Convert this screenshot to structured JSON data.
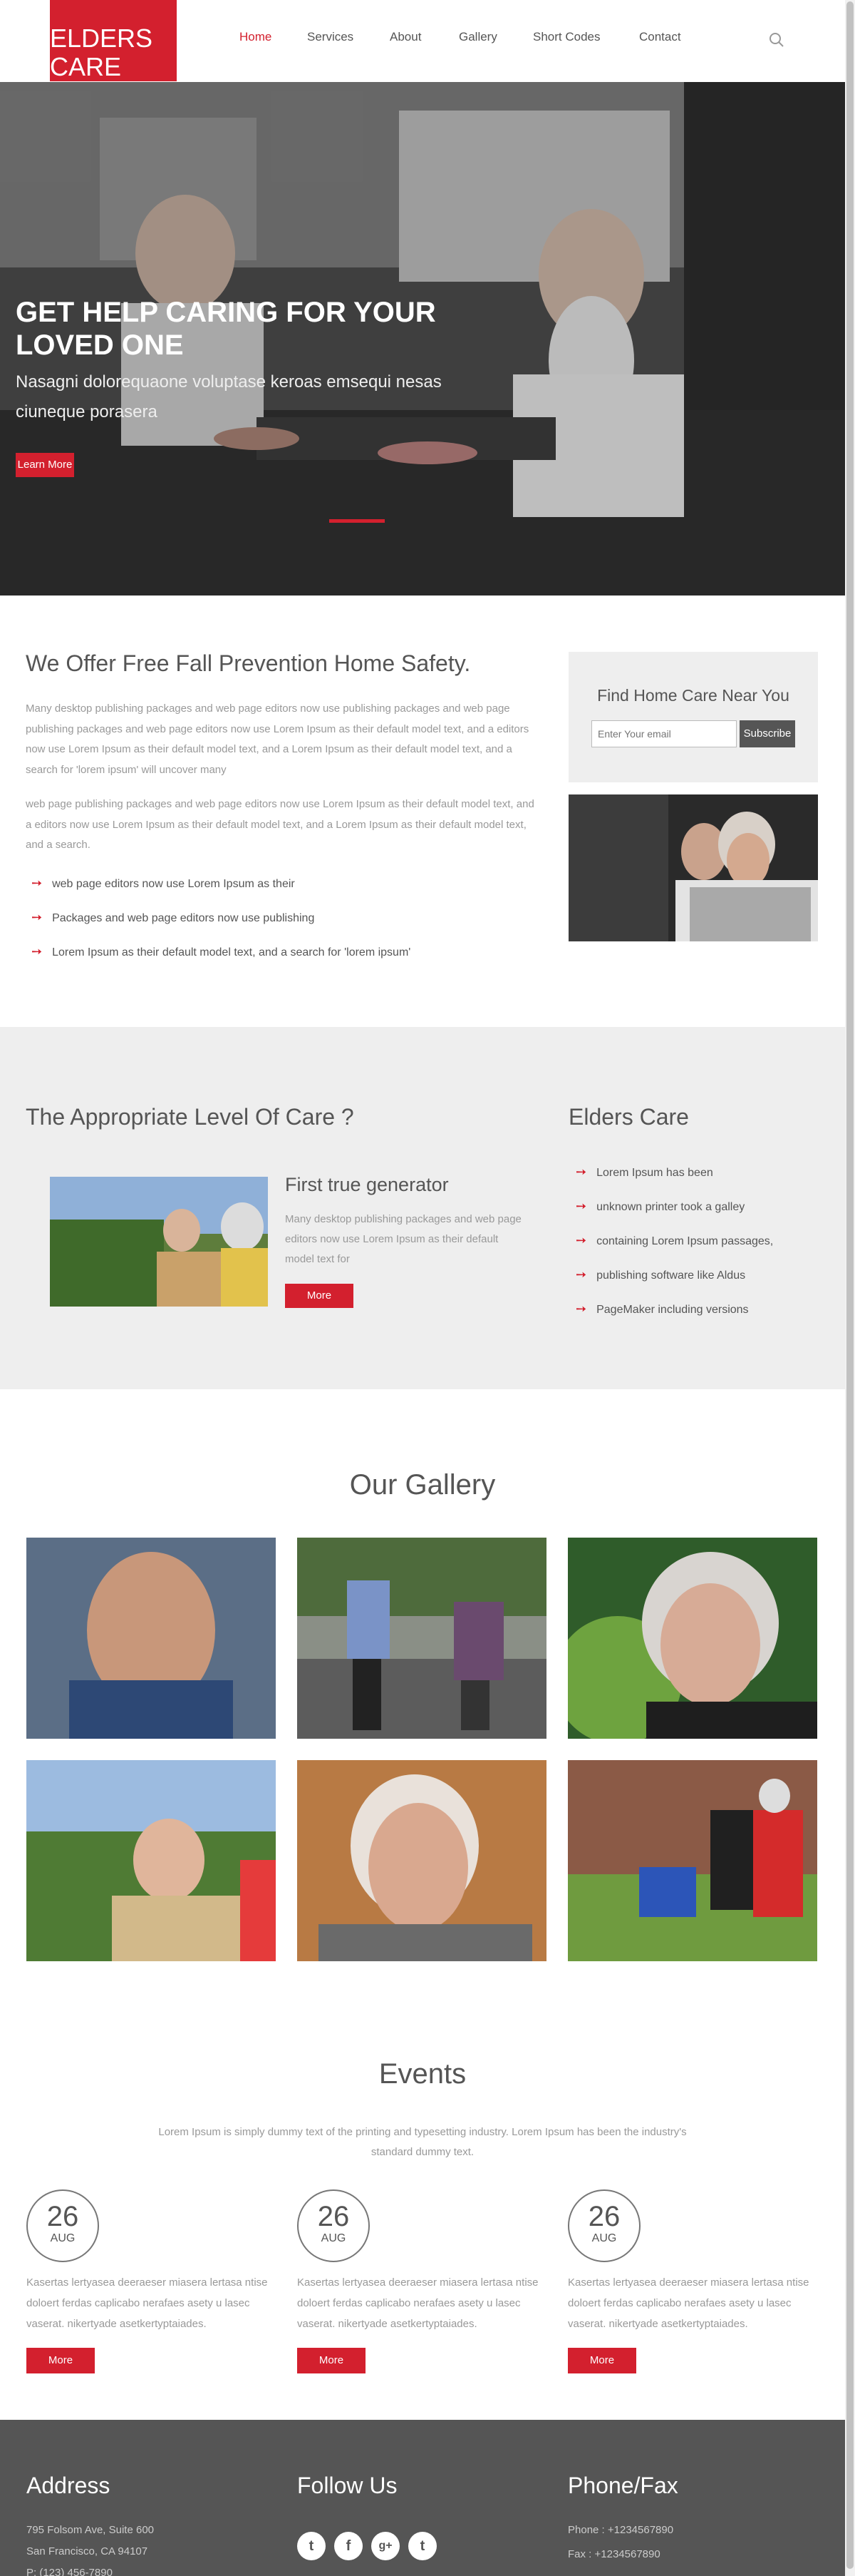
{
  "header": {
    "logo_line1": "ELDERS",
    "logo_line2": "CARE",
    "nav": [
      "Home",
      "Services",
      "About",
      "Gallery",
      "Short Codes",
      "Contact"
    ],
    "active_nav": "Home",
    "search_icon": "search-icon"
  },
  "hero": {
    "title": "GET HELP CARING FOR YOUR LOVED ONE",
    "subtitle": "Nasagni dolorequaone voluptase keroas emsequi nesas ciuneque porasera",
    "button": "Learn More"
  },
  "offer": {
    "title": "We Offer Free Fall Prevention Home Safety.",
    "para1": "Many desktop publishing packages and web page editors now use publishing packages and web page publishing packages and web page editors now use Lorem Ipsum as their default model text, and a editors now use Lorem Ipsum as their default model text, and a Lorem Ipsum as their default model text, and a search for 'lorem ipsum' will uncover many",
    "para2": "web page publishing packages and web page editors now use Lorem Ipsum as their default model text, and a editors now use Lorem Ipsum as their default model text, and a Lorem Ipsum as their default model text, and a search.",
    "bullets": [
      "web page editors now use Lorem Ipsum as their",
      "Packages and web page editors now use publishing",
      "Lorem Ipsum as their default model text, and a search for 'lorem ipsum'"
    ]
  },
  "find": {
    "title": "Find Home Care Near You",
    "placeholder": "Enter Your email",
    "button": "Subscribe"
  },
  "care": {
    "title": "The Appropriate Level Of Care ?",
    "subtitle": "First true generator",
    "text": "Many desktop publishing packages and web page editors now use Lorem Ipsum as their default model text for",
    "button": "More",
    "elders_title": "Elders Care",
    "elders_list": [
      "Lorem Ipsum has been",
      "unknown printer took a galley",
      "containing Lorem Ipsum passages,",
      "publishing software like Aldus",
      "PageMaker including versions"
    ]
  },
  "gallery": {
    "title": "Our Gallery"
  },
  "events": {
    "title": "Events",
    "subtitle": "Lorem Ipsum is simply dummy text of the printing and typesetting industry. Lorem Ipsum has been the industry's standard dummy text.",
    "items": [
      {
        "day": "26",
        "month": "AUG",
        "text": "Kasertas lertyasea deeraeser miasera lertasa ntise doloert ferdas caplicabo nerafaes asety u lasec vaserat. nikertyade asetkertyptaiades.",
        "button": "More"
      },
      {
        "day": "26",
        "month": "AUG",
        "text": "Kasertas lertyasea deeraeser miasera lertasa ntise doloert ferdas caplicabo nerafaes asety u lasec vaserat. nikertyade asetkertyptaiades.",
        "button": "More"
      },
      {
        "day": "26",
        "month": "AUG",
        "text": "Kasertas lertyasea deeraeser miasera lertasa ntise doloert ferdas caplicabo nerafaes asety u lasec vaserat. nikertyade asetkertyptaiades.",
        "button": "More"
      }
    ]
  },
  "footer": {
    "address_title": "Address",
    "address_line1": "795 Folsom Ave, Suite 600",
    "address_line2": "San Francisco, CA 94107",
    "address_line3": "P: (123) 456-7890",
    "follow_title": "Follow Us",
    "social": [
      "twitter-icon",
      "facebook-icon",
      "google-plus-icon",
      "tumblr-icon"
    ],
    "social_glyphs": [
      "t",
      "f",
      "g+",
      "t"
    ],
    "phone_title": "Phone/Fax",
    "phone": "Phone : +1234567890",
    "fax": "Fax : +1234567890"
  },
  "colors": {
    "accent": "#d3202e",
    "footer_bg": "#555555",
    "section_bg": "#eeeeee"
  }
}
